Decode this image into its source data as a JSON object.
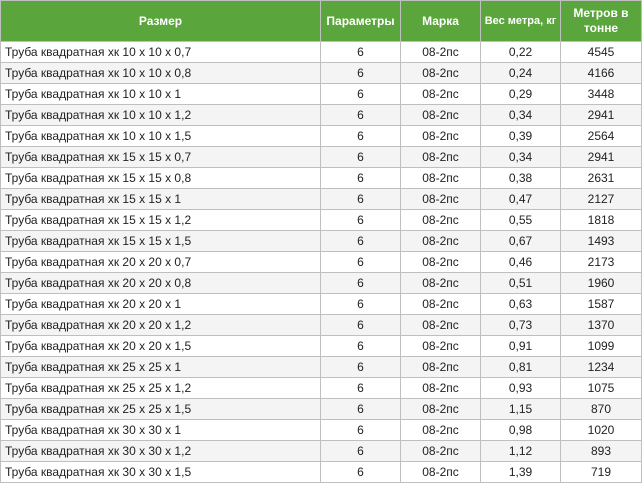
{
  "table": {
    "headers": {
      "size": "Размер",
      "params": "Параметры",
      "grade": "Марка",
      "weight": "Вес метра, кг",
      "per_ton": "Метров в тонне"
    },
    "rows": [
      {
        "size": "Труба квадратная хк 10 x 10 x 0,7",
        "params": "6",
        "grade": "08-2пс",
        "weight": "0,22",
        "per_ton": "4545"
      },
      {
        "size": "Труба квадратная хк 10 x 10 x 0,8",
        "params": "6",
        "grade": "08-2пс",
        "weight": "0,24",
        "per_ton": "4166"
      },
      {
        "size": "Труба квадратная хк 10 x 10 x 1",
        "params": "6",
        "grade": "08-2пс",
        "weight": "0,29",
        "per_ton": "3448"
      },
      {
        "size": "Труба квадратная хк 10 x 10 x 1,2",
        "params": "6",
        "grade": "08-2пс",
        "weight": "0,34",
        "per_ton": "2941"
      },
      {
        "size": "Труба квадратная хк 10 x 10 x 1,5",
        "params": "6",
        "grade": "08-2пс",
        "weight": "0,39",
        "per_ton": "2564"
      },
      {
        "size": "Труба квадратная хк 15 x 15 x 0,7",
        "params": "6",
        "grade": "08-2пс",
        "weight": "0,34",
        "per_ton": "2941"
      },
      {
        "size": "Труба квадратная хк 15 x 15 x 0,8",
        "params": "6",
        "grade": "08-2пс",
        "weight": "0,38",
        "per_ton": "2631"
      },
      {
        "size": "Труба квадратная хк 15 x 15 x 1",
        "params": "6",
        "grade": "08-2пс",
        "weight": "0,47",
        "per_ton": "2127"
      },
      {
        "size": "Труба квадратная хк 15 x 15 x 1,2",
        "params": "6",
        "grade": "08-2пс",
        "weight": "0,55",
        "per_ton": "1818"
      },
      {
        "size": "Труба квадратная хк 15 x 15 x 1,5",
        "params": "6",
        "grade": "08-2пс",
        "weight": "0,67",
        "per_ton": "1493"
      },
      {
        "size": "Труба квадратная хк 20 x 20 x 0,7",
        "params": "6",
        "grade": "08-2пс",
        "weight": "0,46",
        "per_ton": "2173"
      },
      {
        "size": "Труба квадратная хк 20 x 20 x 0,8",
        "params": "6",
        "grade": "08-2пс",
        "weight": "0,51",
        "per_ton": "1960"
      },
      {
        "size": "Труба квадратная хк 20 x 20 x 1",
        "params": "6",
        "grade": "08-2пс",
        "weight": "0,63",
        "per_ton": "1587"
      },
      {
        "size": "Труба квадратная хк 20 x 20 x 1,2",
        "params": "6",
        "grade": "08-2пс",
        "weight": "0,73",
        "per_ton": "1370"
      },
      {
        "size": "Труба квадратная хк 20 x 20 x 1,5",
        "params": "6",
        "grade": "08-2пс",
        "weight": "0,91",
        "per_ton": "1099"
      },
      {
        "size": "Труба квадратная хк 25 x 25 x 1",
        "params": "6",
        "grade": "08-2пс",
        "weight": "0,81",
        "per_ton": "1234"
      },
      {
        "size": "Труба квадратная хк 25 x 25 x 1,2",
        "params": "6",
        "grade": "08-2пс",
        "weight": "0,93",
        "per_ton": "1075"
      },
      {
        "size": "Труба квадратная хк 25 x 25 x 1,5",
        "params": "6",
        "grade": "08-2пс",
        "weight": "1,15",
        "per_ton": "870"
      },
      {
        "size": "Труба квадратная хк 30 x 30 x 1",
        "params": "6",
        "grade": "08-2пс",
        "weight": "0,98",
        "per_ton": "1020"
      },
      {
        "size": "Труба квадратная хк 30 x 30 x 1,2",
        "params": "6",
        "grade": "08-2пс",
        "weight": "1,12",
        "per_ton": "893"
      },
      {
        "size": "Труба квадратная хк 30 x 30 x 1,5",
        "params": "6",
        "grade": "08-2пс",
        "weight": "1,39",
        "per_ton": "719"
      }
    ]
  },
  "colors": {
    "header_bg": "#5aa53c",
    "header_text": "#ffffff",
    "border": "#bfbfbf",
    "cell_text": "#222222"
  }
}
